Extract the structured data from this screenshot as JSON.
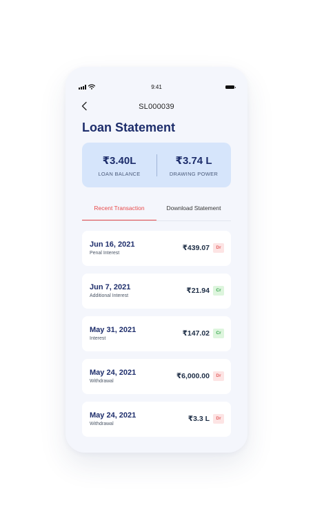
{
  "status_bar": {
    "time": "9:41"
  },
  "nav": {
    "account_id": "SL000039"
  },
  "page_title": "Loan Statement",
  "summary": {
    "loan_balance": {
      "value": "₹3.40L",
      "label": "LOAN BALANCE"
    },
    "drawing_power": {
      "value": "₹3.74 L",
      "label": "DRAWING POWER"
    }
  },
  "tabs": [
    {
      "label": "Recent Transaction",
      "active": true
    },
    {
      "label": "Download Statement",
      "active": false
    }
  ],
  "transactions": [
    {
      "date": "Jun 16, 2021",
      "desc": "Penal Interest",
      "amount": "₹439.07",
      "type": "Dr"
    },
    {
      "date": "Jun 7, 2021",
      "desc": "Additional Interest",
      "amount": "₹21.94",
      "type": "Cr"
    },
    {
      "date": "May 31, 2021",
      "desc": "Interest",
      "amount": "₹147.02",
      "type": "Cr"
    },
    {
      "date": "May 24, 2021",
      "desc": "Withdrawal",
      "amount": "₹6,000.00",
      "type": "Dr"
    },
    {
      "date": "May 24, 2021",
      "desc": "Withdrawal",
      "amount": "₹3.3 L",
      "type": "Dr"
    }
  ],
  "colors": {
    "accent_red": "#e84a4a",
    "navy": "#1d2d6b",
    "summary_bg": "#d6e5fb",
    "debit_badge_bg": "#fde4e4",
    "credit_badge_bg": "#ddf5dd"
  }
}
